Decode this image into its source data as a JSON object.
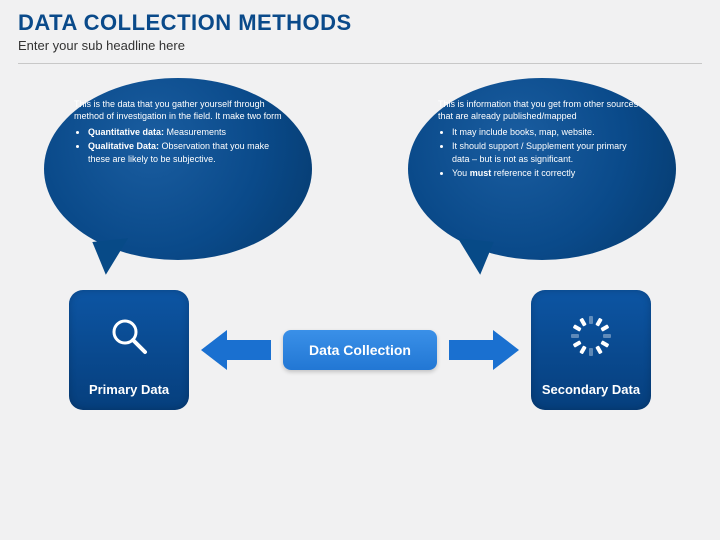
{
  "header": {
    "title": "DATA COLLECTION METHODS",
    "subtitle": "Enter your sub headline here"
  },
  "bubbles": {
    "left": {
      "intro": "This is the data that you gather yourself through method of investigation in the field. It make two form",
      "items": [
        {
          "term": "Quantitative data:",
          "desc": " Measurements"
        },
        {
          "term": "Qualitative Data:",
          "desc": " Observation that you make these are likely to be subjective."
        }
      ]
    },
    "right": {
      "intro": "This is information that you get from other sources that are already published/mapped",
      "items": [
        {
          "desc": "It may include books, map, website."
        },
        {
          "desc": "It should support / Supplement your primary data – but is not as significant."
        },
        {
          "desc_pre": "You ",
          "term": "must",
          "desc_post": " reference it correctly"
        }
      ]
    }
  },
  "flow": {
    "left_node": "Primary Data",
    "center": "Data Collection",
    "right_node": "Secondary Data"
  }
}
